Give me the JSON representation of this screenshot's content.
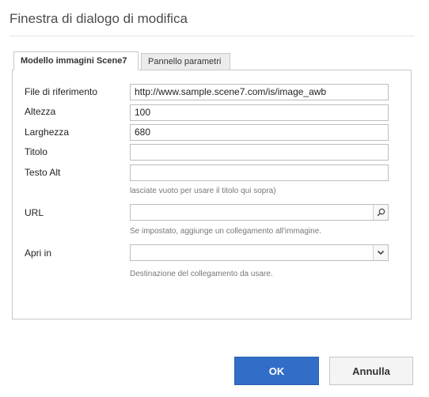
{
  "dialog": {
    "title": "Finestra di dialogo di modifica"
  },
  "tabs": [
    {
      "label": "Modello immagini Scene7",
      "active": true
    },
    {
      "label": "Pannello parametri",
      "active": false
    }
  ],
  "form": {
    "file_label": "File di riferimento",
    "file_value": "http://www.sample.scene7.com/is/image_awb",
    "height_label": "Altezza",
    "height_value": "100",
    "width_label": "Larghezza",
    "width_value": "680",
    "title_label": "Titolo",
    "title_value": "",
    "alt_label": "Testo Alt",
    "alt_value": "",
    "alt_hint": "lasciate vuoto per usare il titolo qui sopra)",
    "url_label": "URL",
    "url_value": "",
    "url_hint": "Se impostato, aggiunge un collegamento all'immagine.",
    "open_label": "Apri in",
    "open_value": "",
    "open_hint": "Destinazione del collegamento da usare."
  },
  "footer": {
    "ok_label": "OK",
    "cancel_label": "Annulla"
  },
  "colors": {
    "primary_button": "#326ec8",
    "border": "#c8c8c8"
  },
  "icons": {
    "url_field": "search-icon",
    "open_select": "chevron-down-icon"
  }
}
